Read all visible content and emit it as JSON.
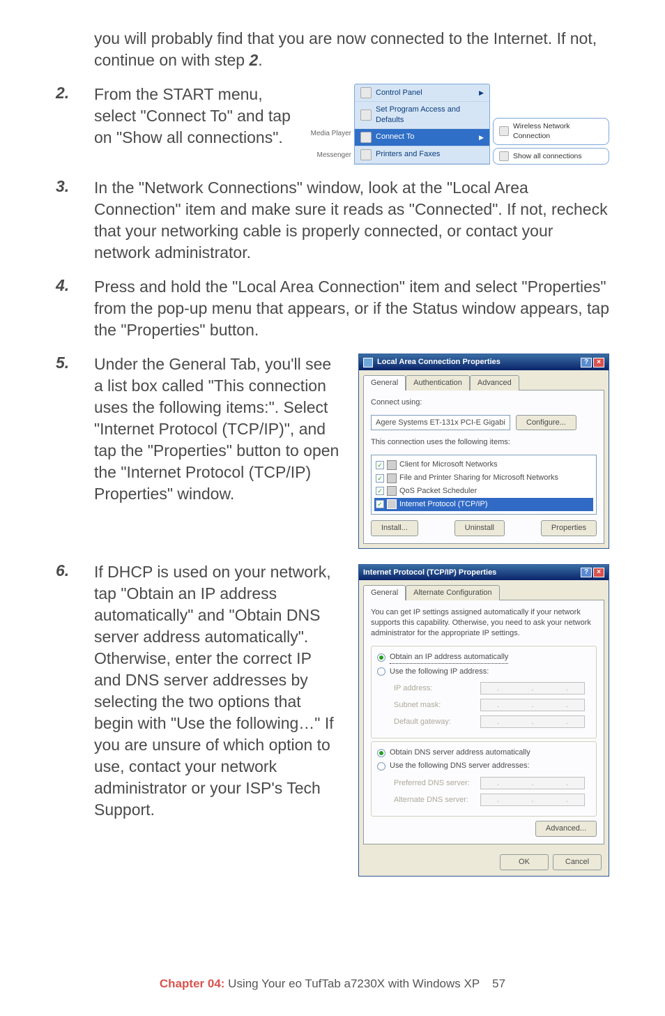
{
  "intro": "you will probably find that you are now connected to the Internet. If not, continue on with step ",
  "intro_ref": "2",
  "steps": {
    "s2": {
      "num": "2.",
      "text": "From the START menu, select \"Connect To\" and tap on \"Show all connections\"."
    },
    "s3": {
      "num": "3.",
      "text": "In the \"Network Connections\" window, look at the  \"Local Area Connection\" item and make sure it reads as \"Connected\". If not, recheck that your networking cable is properly connected, or contact your network administrator."
    },
    "s4": {
      "num": "4.",
      "text": "Press and hold the \"Local Area Connection\" item and select \"Properties\" from the pop-up menu that appears, or if the Status window appears, tap the \"Properties\" button."
    },
    "s5": {
      "num": "5.",
      "text": "Under the General Tab, you'll see a list box called \"This connection uses the following items:\". Select \"Internet Protocol (TCP/IP)\", and tap the \"Properties\" button to open the \"Internet Protocol (TCP/IP) Properties\" window."
    },
    "s6": {
      "num": "6.",
      "text": "If DHCP is used on your network, tap \"Obtain an IP address automatically\" and \"Obtain DNS server address automatically\". Otherwise, enter the correct IP and DNS server addresses by selecting the two options that begin with \"Use the following…\" If you are unsure of which option to use, contact your network administrator or your ISP's Tech Support."
    }
  },
  "fig1": {
    "left": {
      "media_player": "Media Player",
      "messenger": "Messenger"
    },
    "menu": {
      "control_panel": "Control Panel",
      "set_defaults_l1": "Set Program Access and",
      "set_defaults_l2": "Defaults",
      "connect_to": "Connect To",
      "printers": "Printers and Faxes"
    },
    "sub": {
      "wireless": "Wireless Network Connection",
      "show_all": "Show all connections"
    }
  },
  "fig2": {
    "title": "Local Area Connection Properties",
    "tabs": {
      "general": "General",
      "auth": "Authentication",
      "adv": "Advanced"
    },
    "connect_using_label": "Connect using:",
    "adapter": "Agere Systems ET-131x PCI-E Gigabi",
    "configure_btn": "Configure...",
    "uses_label": "This connection uses the following items:",
    "items": {
      "client": "Client for Microsoft Networks",
      "fps": "File and Printer Sharing for Microsoft Networks",
      "qos": "QoS Packet Scheduler",
      "tcpip": "Internet Protocol (TCP/IP)"
    },
    "buttons": {
      "install": "Install...",
      "uninstall": "Uninstall",
      "properties": "Properties"
    }
  },
  "fig3": {
    "title": "Internet Protocol (TCP/IP) Properties",
    "tabs": {
      "general": "General",
      "alt": "Alternate Configuration"
    },
    "desc": "You can get IP settings assigned automatically if your network supports this capability. Otherwise, you need to ask your network administrator for the appropriate IP settings.",
    "ip_auto": "Obtain an IP address automatically",
    "ip_manual": "Use the following IP address:",
    "ip_fields": {
      "ip": "IP address:",
      "subnet": "Subnet mask:",
      "gw": "Default gateway:"
    },
    "dns_auto": "Obtain DNS server address automatically",
    "dns_manual": "Use the following DNS server addresses:",
    "dns_fields": {
      "pref": "Preferred DNS server:",
      "alt": "Alternate DNS server:"
    },
    "advanced_btn": "Advanced...",
    "ok_btn": "OK",
    "cancel_btn": "Cancel"
  },
  "footer": {
    "chapter": "Chapter 04:",
    "title": "  Using Your eo TufTab a7230X with Windows XP",
    "page": "57"
  }
}
